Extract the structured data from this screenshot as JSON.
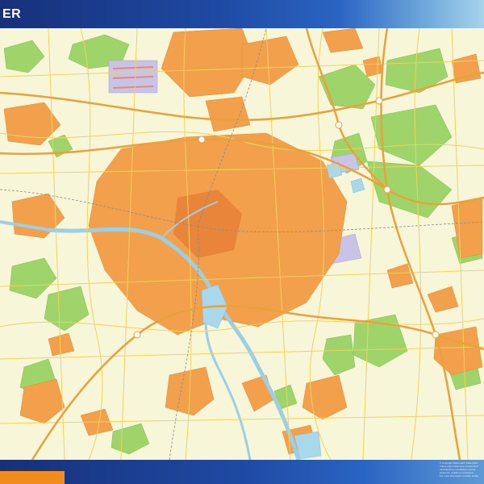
{
  "header": {
    "title": "ER"
  },
  "footer": {
    "copyright_lines": [
      "© Copyright Wallsmap® 1981-2016",
      "These maps have been constructed",
      "reproduction is prohibited, except",
      "electronic, digital or mechanical",
      "For more information contact: info@"
    ]
  },
  "colors": {
    "background": "#f7f6d9",
    "urban": "#f2a04c",
    "urban_dense": "#e8853a",
    "forest": "#9fd46a",
    "water": "#a8d8ea",
    "road": "#f1d35a",
    "highway": "#e9a23a",
    "industrial": "#c9c3e6",
    "header_dark": "#17307a",
    "header_light": "#a7d3ea",
    "footer_accent": "#f28c1c"
  },
  "map": {
    "icons": [
      "highway-junction-icon"
    ]
  }
}
